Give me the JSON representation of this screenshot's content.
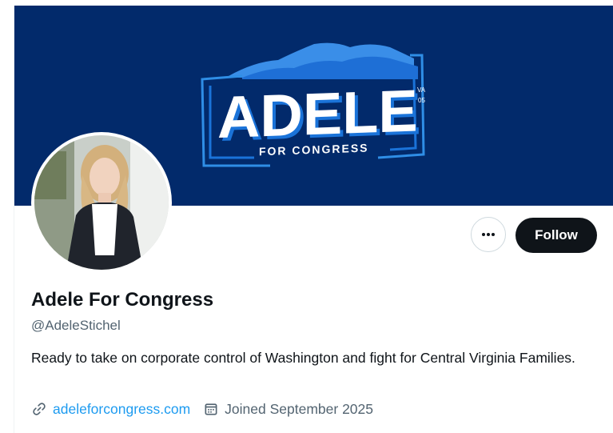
{
  "banner": {
    "logo_name": "ADELE",
    "logo_tagline": "FOR CONGRESS",
    "logo_state": "VA",
    "logo_district": "05"
  },
  "profile": {
    "display_name": "Adele For Congress",
    "handle": "@AdeleStichel",
    "bio": "Ready to take on corporate control of Washington and fight for Central Virginia Families.",
    "website": "adeleforcongress.com",
    "joined": "Joined September 2025"
  },
  "actions": {
    "follow_label": "Follow",
    "more_icon": "more-horizontal-icon"
  },
  "colors": {
    "banner_bg": "#022a6b",
    "follow_bg": "#0f1419",
    "link": "#1d9bf0",
    "secondary_text": "#536471"
  }
}
